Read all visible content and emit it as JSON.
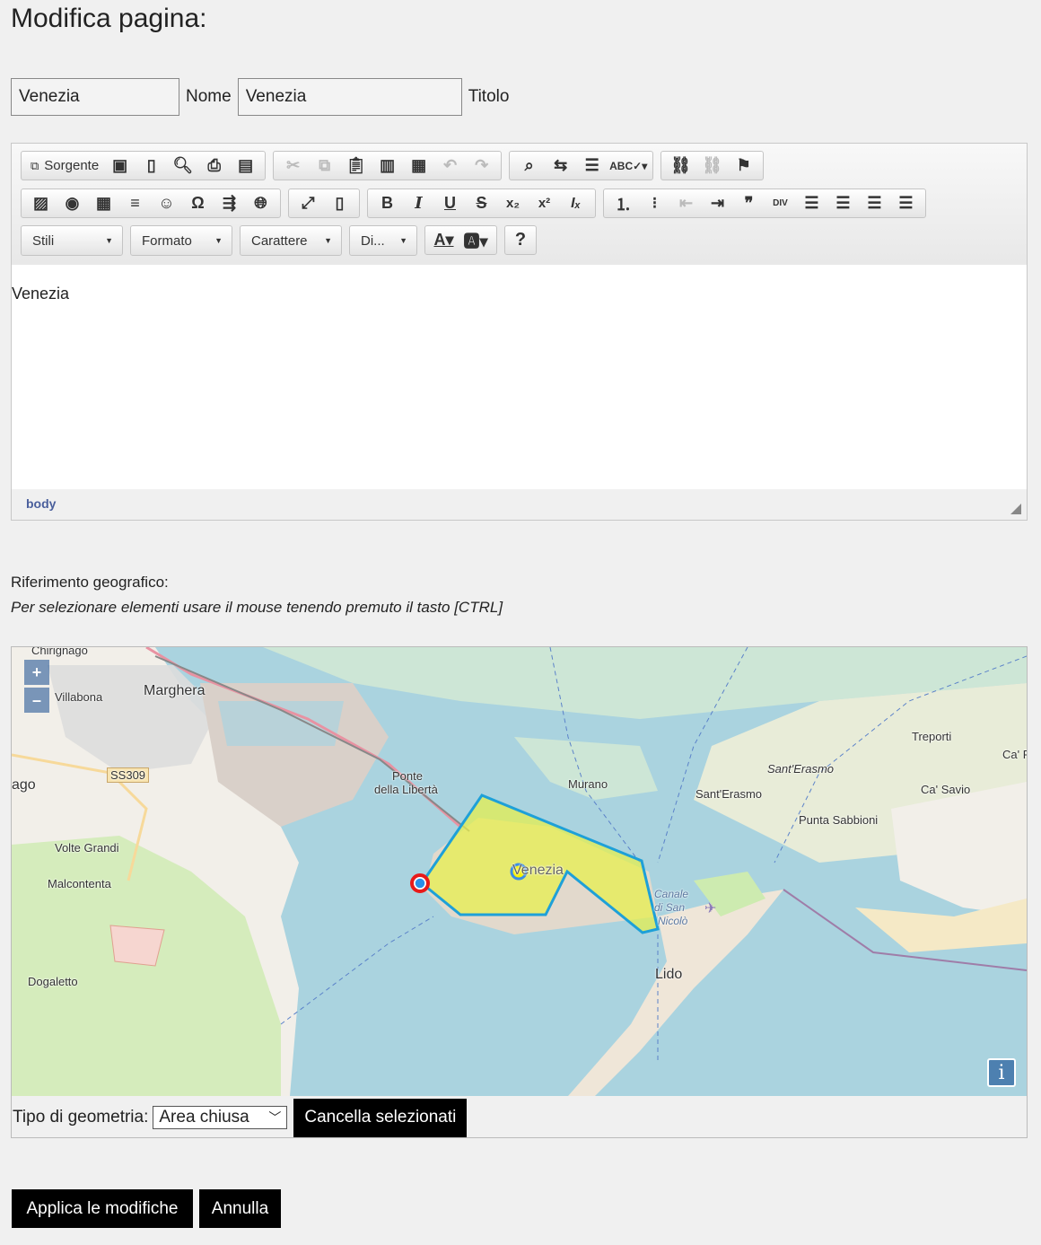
{
  "page": {
    "title": "Modifica pagina:"
  },
  "form": {
    "name_value": "Venezia",
    "name_label": "Nome",
    "title_value": "Venezia",
    "title_label": "Titolo"
  },
  "editor": {
    "source_label": "Sorgente",
    "combos": [
      "Stili",
      "Formato",
      "Carattere",
      "Di..."
    ],
    "content": "Venezia",
    "status_path": "body",
    "help_glyph": "?"
  },
  "geo": {
    "label": "Riferimento geografico:",
    "hint": "Per selezionare elementi usare il mouse tenendo premuto il tasto [CTRL]",
    "zoom_in": "+",
    "zoom_out": "–",
    "info": "i",
    "map_labels": {
      "chirignago": "Chirignago",
      "villabona": "Villabona",
      "marghera": "Marghera",
      "ss309": "SS309",
      "ago": "ago",
      "ponte": "Ponte",
      "liberta": "della Libertà",
      "murano": "Murano",
      "santerasmo_it": "Sant'Erasmo",
      "santerasmo": "Sant'Erasmo",
      "treporti": "Treporti",
      "capi": "Ca' P",
      "casavio": "Ca' Savio",
      "puntasabbioni": "Punta Sabbioni",
      "voltegrandi": "Volte Grandi",
      "malcontenta": "Malcontenta",
      "venezia": "Venezia",
      "canale1": "Canale",
      "canale2": "di San",
      "canale3": "Nicolò",
      "lido": "Lido",
      "dogaletto": "Dogaletto"
    },
    "geometry_label": "Tipo di geometria:",
    "geometry_value": "Area chiusa",
    "clear_button": "Cancella selezionati",
    "colors": {
      "polygon_fill": "#e8f04a",
      "polygon_stroke": "#1ea0d8",
      "water": "#aad3df",
      "land": "#f2efe9"
    }
  },
  "actions": {
    "apply": "Applica le modifiche",
    "cancel": "Annulla"
  }
}
